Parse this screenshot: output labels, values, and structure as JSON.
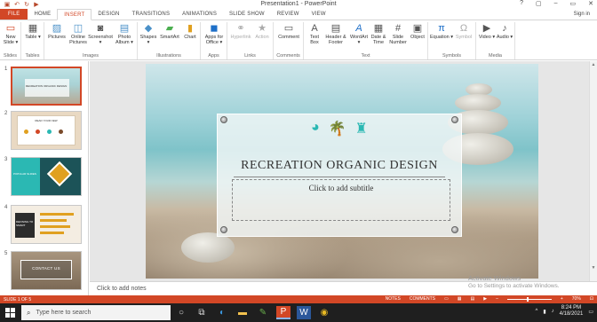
{
  "window": {
    "title": "Presentation1 - PowerPoint",
    "controls": [
      "?",
      "▢",
      "–",
      "▭",
      "✕"
    ]
  },
  "quick_access": [
    "save-icon",
    "undo-icon",
    "redo-icon",
    "present-icon"
  ],
  "tabs": [
    {
      "label": "FILE"
    },
    {
      "label": "HOME"
    },
    {
      "label": "INSERT"
    },
    {
      "label": "DESIGN"
    },
    {
      "label": "TRANSITIONS"
    },
    {
      "label": "ANIMATIONS"
    },
    {
      "label": "SLIDE SHOW"
    },
    {
      "label": "REVIEW"
    },
    {
      "label": "VIEW"
    }
  ],
  "signin": "Sign in",
  "ribbon": {
    "groups": [
      {
        "label": "Slides",
        "buttons": [
          {
            "label": "New Slide ▾",
            "icon": "new-slide-icon"
          }
        ]
      },
      {
        "label": "Tables",
        "buttons": [
          {
            "label": "Table ▾",
            "icon": "table-icon"
          }
        ]
      },
      {
        "label": "Images",
        "buttons": [
          {
            "label": "Pictures",
            "icon": "pictures-icon"
          },
          {
            "label": "Online Pictures",
            "icon": "online-pictures-icon"
          },
          {
            "label": "Screenshot ▾",
            "icon": "screenshot-icon"
          },
          {
            "label": "Photo Album ▾",
            "icon": "photo-album-icon"
          }
        ]
      },
      {
        "label": "Illustrations",
        "buttons": [
          {
            "label": "Shapes ▾",
            "icon": "shapes-icon"
          },
          {
            "label": "SmartArt",
            "icon": "smartart-icon"
          },
          {
            "label": "Chart",
            "icon": "chart-icon"
          }
        ]
      },
      {
        "label": "Apps",
        "buttons": [
          {
            "label": "Apps for Office ▾",
            "icon": "apps-icon"
          }
        ]
      },
      {
        "label": "Links",
        "buttons": [
          {
            "label": "Hyperlink",
            "icon": "hyperlink-icon"
          },
          {
            "label": "Action",
            "icon": "action-icon"
          }
        ]
      },
      {
        "label": "Comments",
        "buttons": [
          {
            "label": "Comment",
            "icon": "comment-icon"
          }
        ]
      },
      {
        "label": "Text",
        "buttons": [
          {
            "label": "Text Box",
            "icon": "text-box-icon"
          },
          {
            "label": "Header & Footer",
            "icon": "header-footer-icon"
          },
          {
            "label": "WordArt ▾",
            "icon": "wordart-icon"
          },
          {
            "label": "Date & Time",
            "icon": "date-time-icon"
          },
          {
            "label": "Slide Number",
            "icon": "slide-number-icon"
          },
          {
            "label": "Object",
            "icon": "object-icon"
          }
        ]
      },
      {
        "label": "Symbols",
        "buttons": [
          {
            "label": "Equation ▾",
            "icon": "equation-icon"
          },
          {
            "label": "Symbol",
            "icon": "symbol-icon"
          }
        ]
      },
      {
        "label": "Media",
        "buttons": [
          {
            "label": "Video ▾",
            "icon": "video-icon"
          },
          {
            "label": "Audio ▾",
            "icon": "audio-icon"
          }
        ]
      }
    ]
  },
  "thumbnails": [
    {
      "num": "1",
      "caption": "RECREATION ORGANIC DESIGN"
    },
    {
      "num": "2",
      "caption": "READ YOUR FEW"
    },
    {
      "num": "3",
      "caption": "POPULAR SLIDES"
    },
    {
      "num": "4",
      "caption": "DEFINING TO SMART"
    },
    {
      "num": "5",
      "caption": "CONTACT US"
    }
  ],
  "slide": {
    "title": "RECREATION ORGANIC DESIGN",
    "subtitle_placeholder": "Click to add subtitle",
    "icons": [
      "beach-ball-icon",
      "palm-tree-icon",
      "sand-bucket-icon"
    ]
  },
  "notes_placeholder": "Click to add notes",
  "watermark": {
    "line1": "Activate Windows",
    "line2": "Go to Settings to activate Windows."
  },
  "status": {
    "slide_info": "SLIDE 1 OF 5",
    "notes": "NOTES",
    "comments": "COMMENTS",
    "zoom": "70%"
  },
  "taskbar": {
    "search_placeholder": "Type here to search",
    "time": "8:24 PM",
    "date": "4/18/2021",
    "apps": [
      "cortana-icon",
      "task-view-icon",
      "edge-icon",
      "file-explorer-icon",
      "paint-icon",
      "powerpoint-icon",
      "word-icon",
      "chrome-icon"
    ]
  },
  "colors": {
    "accent": "#d24726",
    "teal": "#2bb8b3"
  }
}
